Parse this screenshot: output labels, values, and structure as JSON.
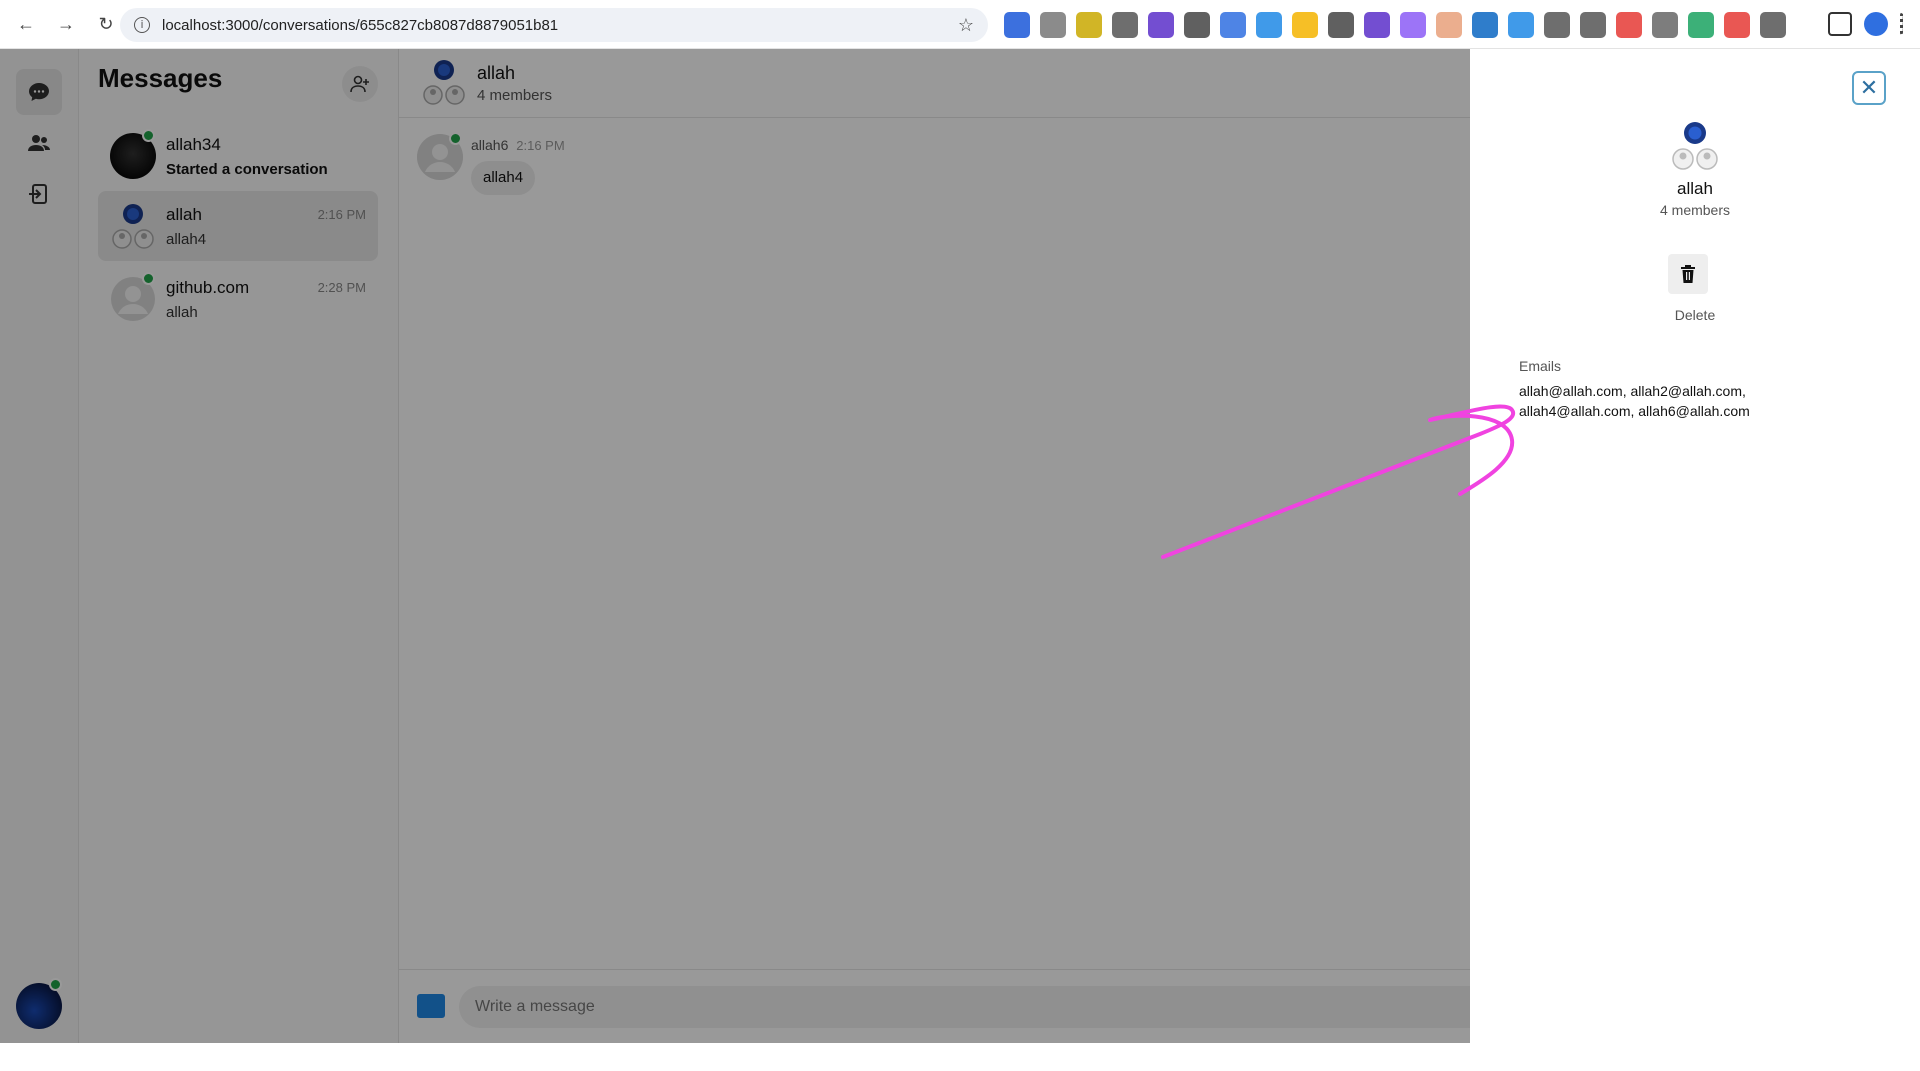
{
  "browser": {
    "url": "localhost:3000/conversations/655c827cb8087d8879051b81",
    "extensions": [
      "#1a57d8",
      "#777",
      "#c9a800",
      "#555",
      "#5b2fc9",
      "#444",
      "#2f6fe0",
      "#1e88e5",
      "#f4b400",
      "#444",
      "#5b2fc9",
      "#8b5cf6",
      "#e8a07a",
      "#0a66c2",
      "#1e88e5",
      "#555",
      "#555",
      "#e53935",
      "#666",
      "#1aa260",
      "#e53935",
      "#555"
    ],
    "icons": {
      "back": "back-arrow-icon",
      "forward": "forward-arrow-icon",
      "reload": "reload-icon",
      "bookmark": "star-icon"
    }
  },
  "sidebar_rail": {
    "items": [
      "chat-bubble-icon",
      "people-icon",
      "logout-icon"
    ]
  },
  "conversations": {
    "title": "Messages",
    "items": [
      {
        "name": "allah34",
        "time": "",
        "last": "Started a conversation",
        "online": true
      },
      {
        "name": "allah",
        "time": "2:16 PM",
        "last": "allah4",
        "online": false
      },
      {
        "name": "github.com",
        "time": "2:28 PM",
        "last": "allah",
        "online": true
      }
    ]
  },
  "chat": {
    "title": "allah",
    "subtitle": "4 members",
    "message": {
      "sender": "allah6",
      "time": "2:16 PM",
      "text": "allah4"
    },
    "composer_placeholder": "Write a message"
  },
  "details": {
    "name": "allah",
    "members": "4 members",
    "delete_label": "Delete",
    "emails_label": "Emails",
    "emails_line1": "allah@allah.com, allah2@allah.com,",
    "emails_line2": "allah4@allah.com, allah6@allah.com"
  },
  "colors": {
    "online": "#22a34a",
    "accent": "#1e88e5",
    "annotation": "#f043e0"
  }
}
